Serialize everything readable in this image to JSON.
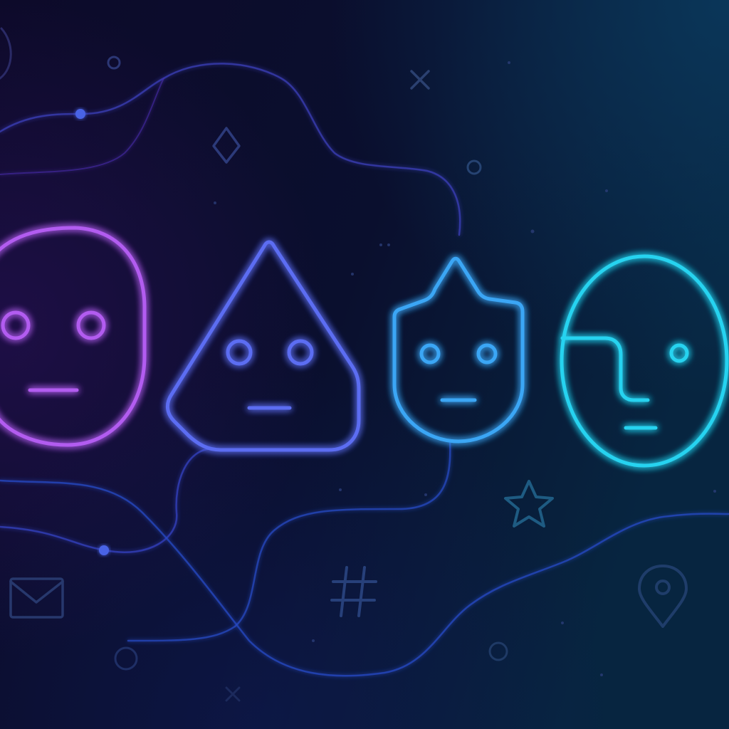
{
  "palette": {
    "background_left": "#0c0b28",
    "background_right": "#07233f",
    "face_violet": "#a855f7",
    "face_indigo": "#6366f1",
    "face_blue": "#3b82f6",
    "face_cyan": "#22d3ee",
    "icon_dim": "#1f3a66",
    "line_glow": "#3b4fd8"
  },
  "faces": [
    {
      "name": "round-face",
      "color": "#b25cf0"
    },
    {
      "name": "triangle-face",
      "color": "#5b6df2"
    },
    {
      "name": "crowned-face",
      "color": "#3aa6f5"
    },
    {
      "name": "profile-face",
      "color": "#28d3f0"
    }
  ],
  "icons": [
    "mail-icon",
    "hash-icon",
    "star-icon",
    "map-pin-icon",
    "diamond-icon",
    "close-icon",
    "circle-icon",
    "dot-icon"
  ]
}
